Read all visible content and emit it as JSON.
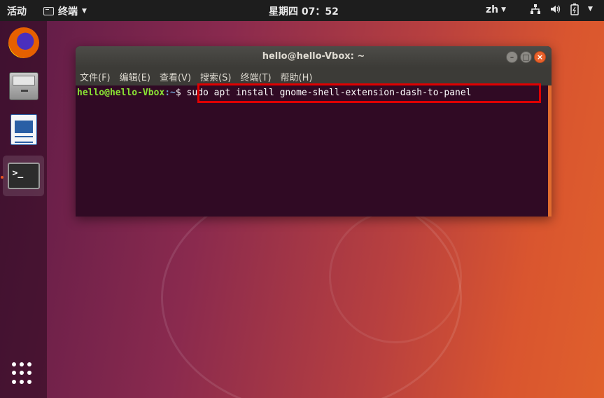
{
  "topbar": {
    "activities": "活动",
    "app_name": "终端",
    "clock": "星期四 07：52",
    "lang": "zh"
  },
  "dock": {
    "items": [
      {
        "name": "firefox"
      },
      {
        "name": "files"
      },
      {
        "name": "libreoffice-writer"
      },
      {
        "name": "terminal",
        "active": true
      }
    ],
    "terminal_glyph": ">_"
  },
  "window": {
    "title": "hello@hello-Vbox: ~",
    "menu": [
      "文件(F)",
      "编辑(E)",
      "查看(V)",
      "搜索(S)",
      "终端(T)",
      "帮助(H)"
    ],
    "prompt_user": "hello@hello-Vbox",
    "prompt_path": ":~",
    "prompt_symbol": "$ ",
    "command": "sudo apt install gnome-shell-extension-dash-to-panel",
    "highlight_color": "#e00000"
  },
  "colors": {
    "terminal_bg": "#300a24",
    "accent": "#e95420"
  }
}
